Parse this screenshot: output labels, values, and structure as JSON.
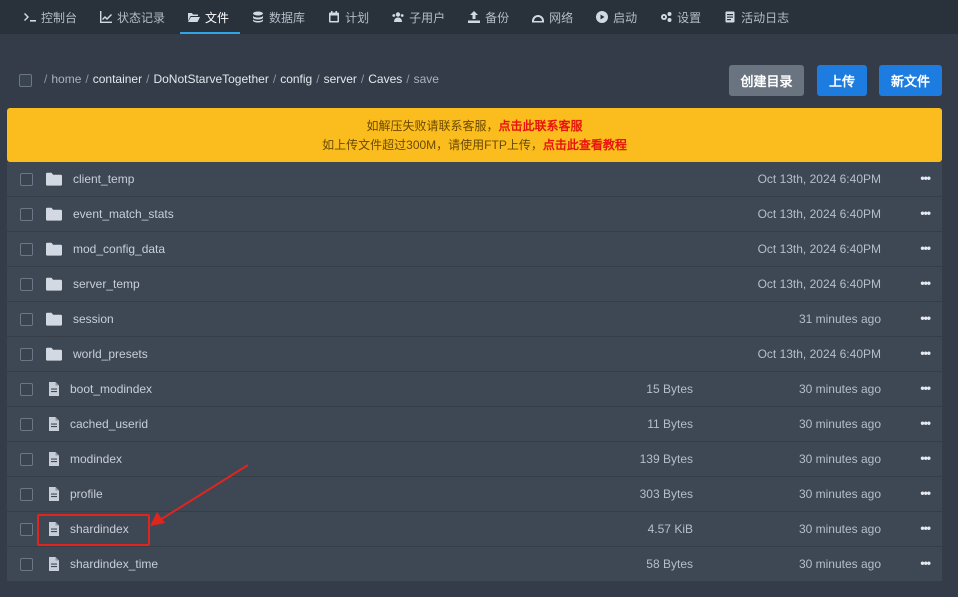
{
  "nav": {
    "items": [
      {
        "label": "控制台",
        "icon": "terminal-icon"
      },
      {
        "label": "状态记录",
        "icon": "chart-icon"
      },
      {
        "label": "文件",
        "icon": "folder-open-icon",
        "active": true
      },
      {
        "label": "数据库",
        "icon": "database-icon"
      },
      {
        "label": "计划",
        "icon": "calendar-icon"
      },
      {
        "label": "子用户",
        "icon": "users-icon"
      },
      {
        "label": "备份",
        "icon": "upload-icon"
      },
      {
        "label": "网络",
        "icon": "network-icon"
      },
      {
        "label": "启动",
        "icon": "play-icon"
      },
      {
        "label": "设置",
        "icon": "gears-icon"
      },
      {
        "label": "活动日志",
        "icon": "log-icon"
      }
    ]
  },
  "breadcrumb": {
    "segments": [
      "home",
      "container",
      "DoNotStarveTogether",
      "config",
      "server",
      "Caves",
      "save"
    ],
    "separator": "/"
  },
  "toolbar": {
    "mkdir_label": "创建目录",
    "upload_label": "上传",
    "newfile_label": "新文件"
  },
  "notice": {
    "line1_text": "如解压失败请联系客服，",
    "line1_link": "点击此联系客服",
    "line2_text": "如上传文件超过300M，请使用FTP上传，",
    "line2_link": "点击此查看教程"
  },
  "files": [
    {
      "name": "client_temp",
      "type": "dir",
      "size": "",
      "date": "Oct 13th, 2024 6:40PM"
    },
    {
      "name": "event_match_stats",
      "type": "dir",
      "size": "",
      "date": "Oct 13th, 2024 6:40PM"
    },
    {
      "name": "mod_config_data",
      "type": "dir",
      "size": "",
      "date": "Oct 13th, 2024 6:40PM"
    },
    {
      "name": "server_temp",
      "type": "dir",
      "size": "",
      "date": "Oct 13th, 2024 6:40PM"
    },
    {
      "name": "session",
      "type": "dir",
      "size": "",
      "date": "31 minutes ago"
    },
    {
      "name": "world_presets",
      "type": "dir",
      "size": "",
      "date": "Oct 13th, 2024 6:40PM"
    },
    {
      "name": "boot_modindex",
      "type": "file",
      "size": "15 Bytes",
      "date": "30 minutes ago"
    },
    {
      "name": "cached_userid",
      "type": "file",
      "size": "11 Bytes",
      "date": "30 minutes ago"
    },
    {
      "name": "modindex",
      "type": "file",
      "size": "139 Bytes",
      "date": "30 minutes ago"
    },
    {
      "name": "profile",
      "type": "file",
      "size": "303 Bytes",
      "date": "30 minutes ago"
    },
    {
      "name": "shardindex",
      "type": "file",
      "size": "4.57 KiB",
      "date": "30 minutes ago",
      "highlighted": true
    },
    {
      "name": "shardindex_time",
      "type": "file",
      "size": "58 Bytes",
      "date": "30 minutes ago"
    }
  ],
  "row_menu_label": "•••",
  "colors": {
    "accent": "#1c7ce0",
    "notice_bg": "#fbbd1e",
    "notice_link": "#e8140d",
    "annotation": "#e0251f"
  }
}
